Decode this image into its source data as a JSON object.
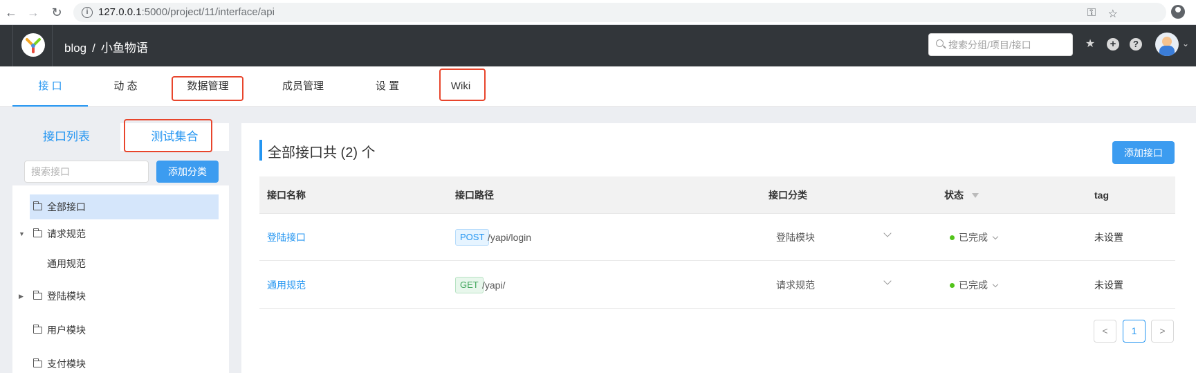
{
  "browser": {
    "url_host": "127.0.0.1",
    "url_path": ":5000/project/11/interface/api"
  },
  "header": {
    "crumb_group": "blog",
    "crumb_separator": "/",
    "crumb_project": "小鱼物语",
    "search_placeholder": "搜索分组/项目/接口"
  },
  "subnav": {
    "tabs": [
      {
        "label": "接 口",
        "active": true
      },
      {
        "label": "动 态"
      },
      {
        "label": "数据管理"
      },
      {
        "label": "成员管理"
      },
      {
        "label": "设 置"
      },
      {
        "label": "Wiki"
      }
    ]
  },
  "left_panel": {
    "tab_list": "接口列表",
    "tab_collection": "测试集合",
    "search_placeholder": "搜索接口",
    "add_category_label": "添加分类",
    "tree": [
      {
        "label": "全部接口",
        "selected": true
      },
      {
        "label": "请求规范",
        "expanded": true
      },
      {
        "label": "通用规范",
        "child": true
      },
      {
        "label": "登陆模块",
        "collapsed": true
      },
      {
        "label": "用户模块"
      },
      {
        "label": "支付模块"
      }
    ]
  },
  "main": {
    "title": "全部接口共 (2) 个",
    "add_api_label": "添加接口",
    "columns": [
      "接口名称",
      "接口路径",
      "接口分类",
      "状态",
      "tag"
    ],
    "rows": [
      {
        "name": "登陆接口",
        "method": "POST",
        "path": "/yapi/login",
        "category": "登陆模块",
        "status": "已完成",
        "tag": "未设置"
      },
      {
        "name": "通用规范",
        "method": "GET",
        "path": "/yapi/",
        "category": "请求规范",
        "status": "已完成",
        "tag": "未设置"
      }
    ],
    "pagination": {
      "prev": "<",
      "current": "1",
      "next": ">"
    }
  },
  "colors": {
    "accent": "#2395f1",
    "header_bg": "#32363a",
    "highlight": "#e8452c",
    "status_done": "#52c41a"
  }
}
